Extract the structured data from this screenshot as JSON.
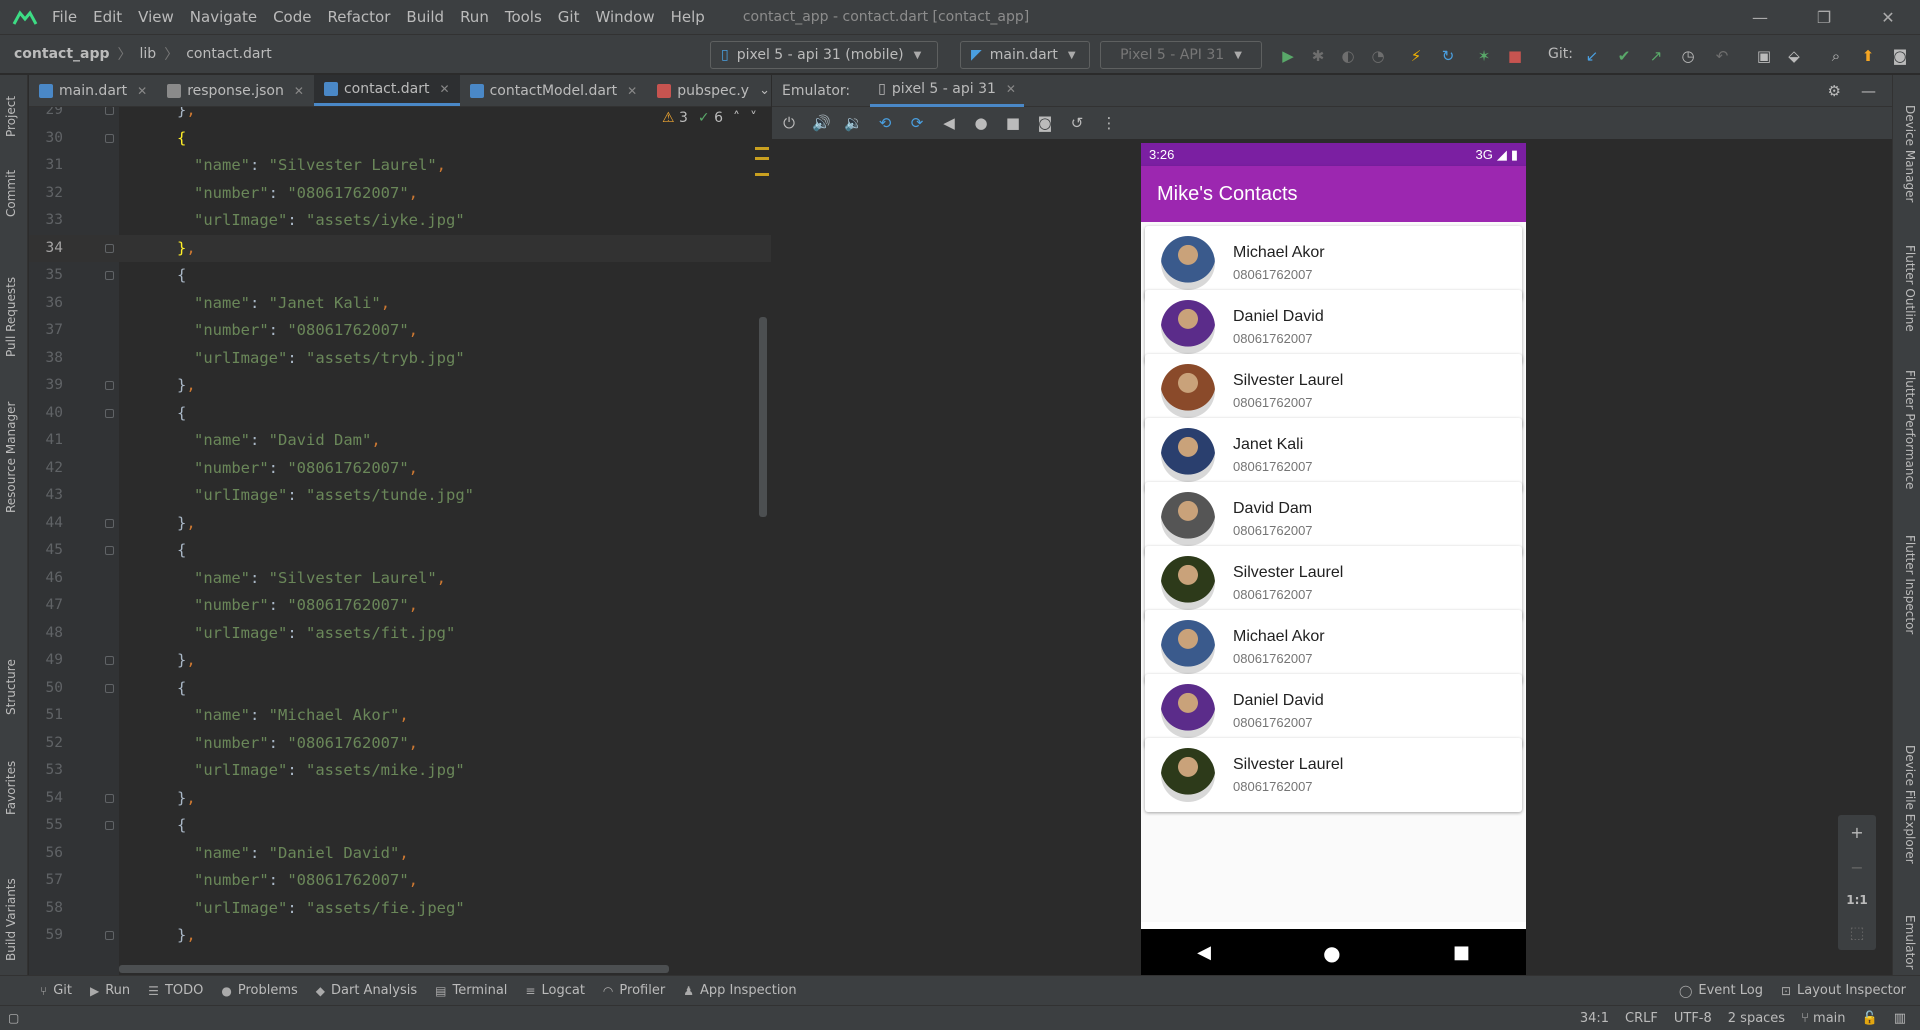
{
  "menubar": {
    "items": [
      "File",
      "Edit",
      "View",
      "Navigate",
      "Code",
      "Refactor",
      "Build",
      "Run",
      "Tools",
      "Git",
      "Window",
      "Help"
    ],
    "title": "contact_app - contact.dart [contact_app]"
  },
  "navbar": {
    "project": "contact_app",
    "folder": "lib",
    "file": "contact.dart",
    "device_combo": "pixel 5 - api 31 (mobile)",
    "config_combo": "main.dart",
    "avd_combo": "Pixel 5 - API 31",
    "git_label": "Git:"
  },
  "editor_tabs": [
    {
      "label": "main.dart"
    },
    {
      "label": "response.json"
    },
    {
      "label": "contact.dart"
    },
    {
      "label": "contactModel.dart"
    },
    {
      "label": "pubspec.y"
    }
  ],
  "inspections": {
    "warnings": "3",
    "weak_warnings": "6"
  },
  "code_lines": [
    {
      "n": "29",
      "k": "close"
    },
    {
      "n": "30",
      "k": "open"
    },
    {
      "n": "31",
      "k": "name",
      "v": "Silvester Laurel"
    },
    {
      "n": "32",
      "k": "number",
      "v": "08061762007"
    },
    {
      "n": "33",
      "k": "url",
      "v": "assets/iyke.jpg"
    },
    {
      "n": "34",
      "k": "close"
    },
    {
      "n": "35",
      "k": "open"
    },
    {
      "n": "36",
      "k": "name",
      "v": "Janet Kali"
    },
    {
      "n": "37",
      "k": "number",
      "v": "08061762007"
    },
    {
      "n": "38",
      "k": "url",
      "v": "assets/tryb.jpg"
    },
    {
      "n": "39",
      "k": "close"
    },
    {
      "n": "40",
      "k": "open"
    },
    {
      "n": "41",
      "k": "name",
      "v": "David Dam"
    },
    {
      "n": "42",
      "k": "number",
      "v": "08061762007"
    },
    {
      "n": "43",
      "k": "url",
      "v": "assets/tunde.jpg"
    },
    {
      "n": "44",
      "k": "close"
    },
    {
      "n": "45",
      "k": "open"
    },
    {
      "n": "46",
      "k": "name",
      "v": "Silvester Laurel"
    },
    {
      "n": "47",
      "k": "number",
      "v": "08061762007"
    },
    {
      "n": "48",
      "k": "url",
      "v": "assets/fit.jpg"
    },
    {
      "n": "49",
      "k": "close"
    },
    {
      "n": "50",
      "k": "open"
    },
    {
      "n": "51",
      "k": "name",
      "v": "Michael Akor"
    },
    {
      "n": "52",
      "k": "number",
      "v": "08061762007"
    },
    {
      "n": "53",
      "k": "url",
      "v": "assets/mike.jpg"
    },
    {
      "n": "54",
      "k": "close"
    },
    {
      "n": "55",
      "k": "open"
    },
    {
      "n": "56",
      "k": "name",
      "v": "Daniel David"
    },
    {
      "n": "57",
      "k": "number",
      "v": "08061762007"
    },
    {
      "n": "58",
      "k": "url",
      "v": "assets/fie.jpeg"
    },
    {
      "n": "59",
      "k": "close"
    }
  ],
  "current_line": "34",
  "emulator": {
    "label": "Emulator:",
    "tab": "pixel 5 - api 31"
  },
  "phone": {
    "time": "3:26",
    "network": "3G",
    "app_title": "Mike's Contacts",
    "contacts": [
      {
        "name": "Michael Akor",
        "number": "08061762007",
        "tone": "#3a5a8c"
      },
      {
        "name": "Daniel David",
        "number": "08061762007",
        "tone": "#5b2c8a"
      },
      {
        "name": "Silvester Laurel",
        "number": "08061762007",
        "tone": "#8a4a2a"
      },
      {
        "name": "Janet Kali",
        "number": "08061762007",
        "tone": "#2a3f6e"
      },
      {
        "name": "David Dam",
        "number": "08061762007",
        "tone": "#555555"
      },
      {
        "name": "Silvester Laurel",
        "number": "08061762007",
        "tone": "#2d3a1a"
      },
      {
        "name": "Michael Akor",
        "number": "08061762007",
        "tone": "#3a5a8c"
      },
      {
        "name": "Daniel David",
        "number": "08061762007",
        "tone": "#5b2c8a"
      },
      {
        "name": "Silvester Laurel",
        "number": "08061762007",
        "tone": "#2d3a1a"
      }
    ]
  },
  "zoom": {
    "plus": "+",
    "minus": "−",
    "one_to_one": "1:1"
  },
  "left_tools": [
    "Project",
    "Commit",
    "Pull Requests",
    "Resource Manager",
    "Structure",
    "Favorites",
    "Build Variants"
  ],
  "right_tools": [
    "Device Manager",
    "Flutter Outline",
    "Flutter Performance",
    "Flutter Inspector",
    "Device File Explorer",
    "Emulator"
  ],
  "bottom_tabs": [
    "Git",
    "Run",
    "TODO",
    "Problems",
    "Dart Analysis",
    "Terminal",
    "Logcat",
    "Profiler",
    "App Inspection"
  ],
  "bottom_right_tabs": [
    "Event Log",
    "Layout Inspector"
  ],
  "status": {
    "position": "34:1",
    "line_sep": "CRLF",
    "encoding": "UTF-8",
    "indent": "2 spaces",
    "branch": "main"
  },
  "colors": {
    "status_bar": "#7b1fa2",
    "app_bar": "#9c27b0",
    "ide_bg": "#2b2b2b",
    "string": "#6a8759"
  }
}
